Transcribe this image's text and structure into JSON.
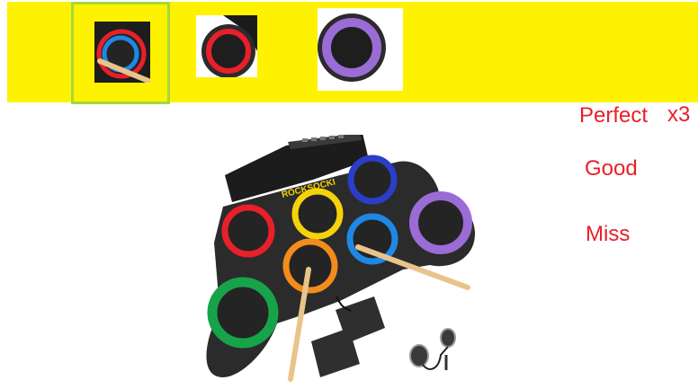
{
  "colors": {
    "note_bar": "#fff200",
    "hit_zone_border": "#a6d83a",
    "judgement_text": "#e8202a",
    "pad_red": "#e8202a",
    "pad_blue": "#1e88e5",
    "pad_purple": "#9b6bd6",
    "pad_yellow": "#f6d20a",
    "pad_navy": "#2b3ec9",
    "pad_orange": "#f28c1c",
    "pad_green": "#17a34a",
    "pad_body": "#2b2b2b"
  },
  "notes": [
    {
      "pad": "red-blue-ring",
      "state": "in-hit-zone"
    },
    {
      "pad": "red-ring",
      "state": "incoming"
    },
    {
      "pad": "purple-ring",
      "state": "incoming"
    }
  ],
  "judgements": {
    "perfect_label": "Perfect",
    "combo": "x3",
    "good_label": "Good",
    "miss_label": "Miss"
  },
  "drum_kit": {
    "brand": "ROCKSOCKI",
    "pads": [
      "yellow",
      "navy",
      "red",
      "purple",
      "blue",
      "orange",
      "green"
    ]
  }
}
